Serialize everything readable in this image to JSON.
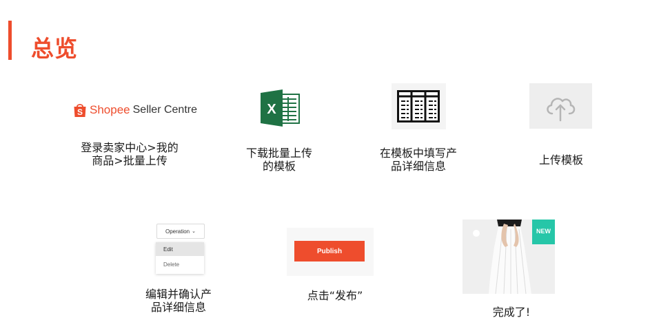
{
  "header": {
    "title": "总览"
  },
  "colors": {
    "accent": "#ee4d2d",
    "excel_green": "#1f7244",
    "badge_teal": "#26c6a8"
  },
  "steps": [
    {
      "logo": {
        "brand": "Shopee",
        "suffix": "Seller Centre"
      },
      "caption_lines": [
        "登录卖家中心>我的",
        "商品>批量上传"
      ]
    },
    {
      "icon": "excel-icon",
      "caption_lines": [
        "下载批量上传",
        "的模板"
      ]
    },
    {
      "icon": "table-template-icon",
      "caption_lines": [
        "在模板中填写产",
        "品详细信息"
      ]
    },
    {
      "icon": "cloud-upload-icon",
      "caption_lines": [
        "上传模板"
      ]
    },
    {
      "dropdown": {
        "label": "Operation",
        "items": [
          "Edit",
          "Delete"
        ]
      },
      "caption_lines": [
        "编辑并确认产",
        "品详细信息"
      ]
    },
    {
      "button": {
        "label": "Publish"
      },
      "caption_lines": [
        "点击“发布”"
      ]
    },
    {
      "image": {
        "badge": "NEW"
      },
      "caption_lines": [
        "完成了!"
      ]
    }
  ]
}
